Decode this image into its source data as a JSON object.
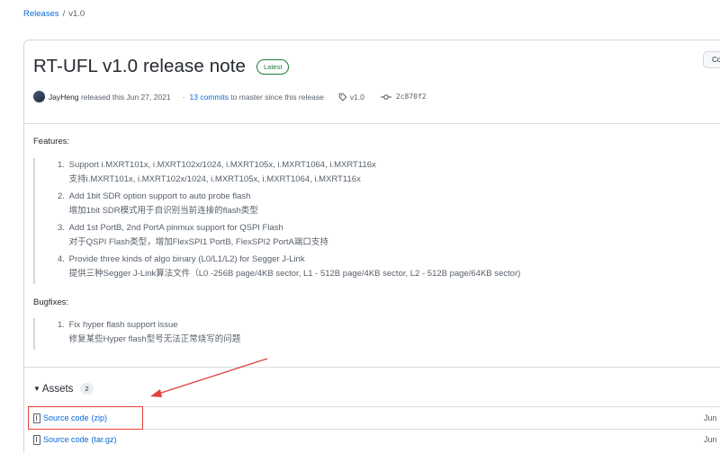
{
  "breadcrumb": {
    "root": "Releases",
    "separator": "/",
    "current": "v1.0"
  },
  "release": {
    "title": "RT-UFL v1.0 release note",
    "badge": "Latest",
    "edit_label": "Co",
    "author": "JayHeng",
    "released_text": "released this Jun 27, 2021",
    "dot": "·",
    "commits_link": "13 commits",
    "commits_suffix": "to master since this release",
    "tag": "v1.0",
    "commit": "2c870f2"
  },
  "notes": {
    "features_label": "Features:",
    "features": [
      {
        "num": "1.",
        "en": "Support i.MXRT101x, i.MXRT102x/1024, i.MXRT105x, i.MXRT1064, i.MXRT116x",
        "zh": "支持i.MXRT101x, i.MXRT102x/1024, i.MXRT105x, i.MXRT1064, i.MXRT116x"
      },
      {
        "num": "2.",
        "en": "Add 1bit SDR option support to auto probe flash",
        "zh": "增加1bit SDR模式用于自识别当前连接的flash类型"
      },
      {
        "num": "3.",
        "en": "Add 1st PortB, 2nd PortA pinmux support for QSPI Flash",
        "zh": "对于QSPI Flash类型，增加FlexSPI1 PortB, FlexSPI2 PortA端口支持"
      },
      {
        "num": "4.",
        "en": "Provide three kinds of algo binary (L0/L1/L2) for Segger J-Link",
        "zh": "提供三种Segger J-Link算法文件（L0 -256B page/4KB sector, L1 - 512B page/4KB sector, L2 - 512B page/64KB sector)"
      }
    ],
    "bugfixes_label": "Bugfixes:",
    "bugfixes": [
      {
        "num": "1.",
        "en": "Fix hyper flash support issue",
        "zh": "修复某些Hyper flash型号无法正常烧写的问题"
      }
    ]
  },
  "assets": {
    "title": "Assets",
    "count": "2",
    "items": [
      {
        "name": "Source code",
        "ext": "(zip)",
        "date": "Jun"
      },
      {
        "name": "Source code",
        "ext": "(tar.gz)",
        "date": "Jun"
      }
    ]
  },
  "annotation_color": "#e0403a"
}
